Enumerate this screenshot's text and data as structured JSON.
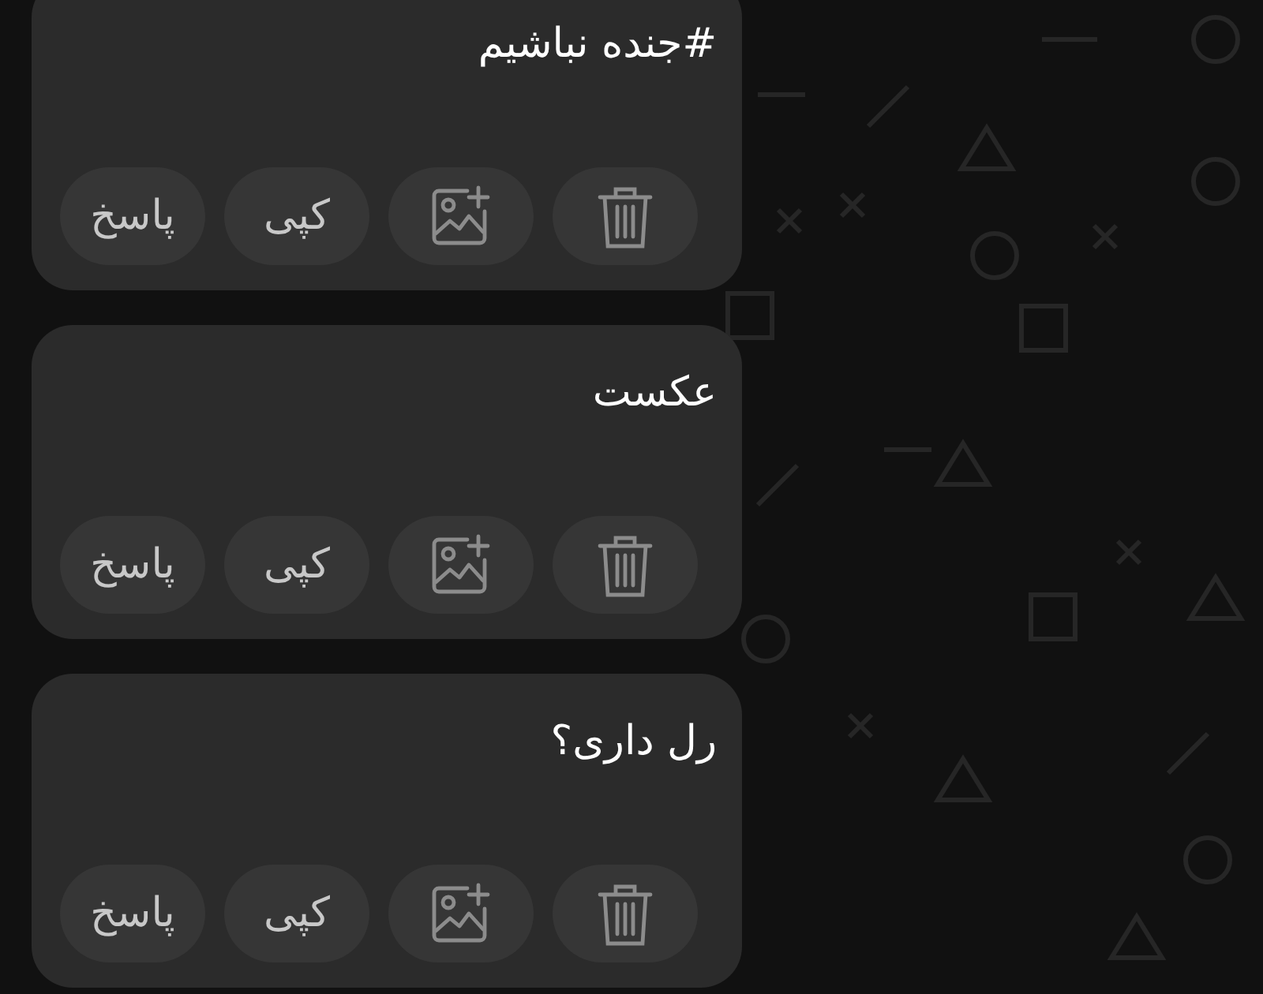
{
  "messages": [
    {
      "text": "#جنده نباشیم",
      "actions": [
        {
          "kind": "delete"
        },
        {
          "kind": "add-image"
        },
        {
          "kind": "text",
          "label": "کپی"
        },
        {
          "kind": "text",
          "label": "پاسخ"
        }
      ]
    },
    {
      "text": "عکست",
      "actions": [
        {
          "kind": "delete"
        },
        {
          "kind": "add-image"
        },
        {
          "kind": "text",
          "label": "کپی"
        },
        {
          "kind": "text",
          "label": "پاسخ"
        }
      ]
    },
    {
      "text": "رل داری؟",
      "actions": [
        {
          "kind": "delete"
        },
        {
          "kind": "add-image"
        },
        {
          "kind": "text",
          "label": "کپی"
        },
        {
          "kind": "text",
          "label": "پاسخ"
        }
      ]
    }
  ]
}
